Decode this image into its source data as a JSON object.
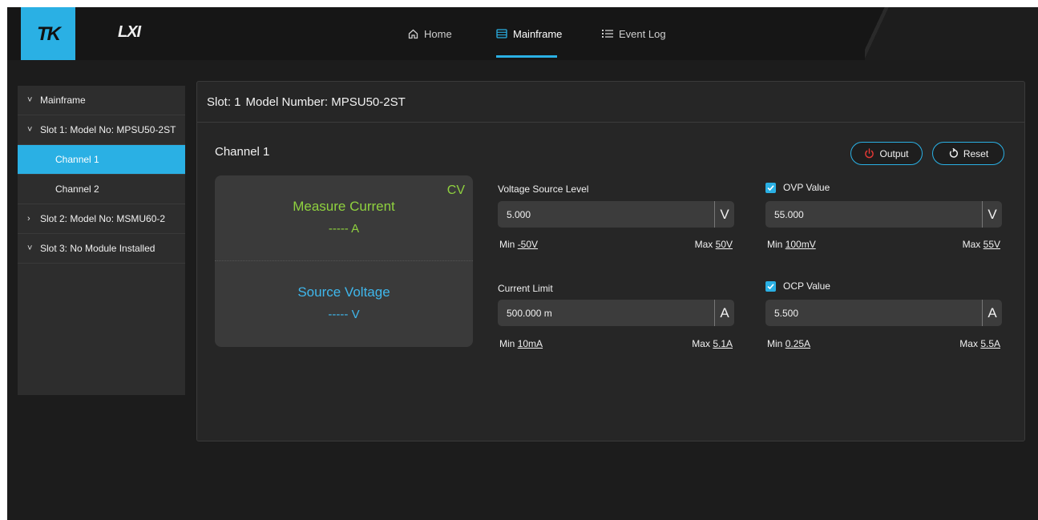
{
  "brand": {
    "logo_text": "TK",
    "lxi_text": "LXI"
  },
  "nav": {
    "home": "Home",
    "mainframe": "Mainframe",
    "event_log": "Event Log",
    "active": "Mainframe"
  },
  "sidebar": {
    "items": [
      {
        "label": "Mainframe",
        "chevron": "˅"
      },
      {
        "label": "Slot 1: Model No: MPSU50-2ST",
        "chevron": "˅"
      },
      {
        "label": "Channel 1",
        "active": true
      },
      {
        "label": "Channel 2"
      },
      {
        "label": "Slot 2: Model No: MSMU60-2",
        "chevron": "›"
      },
      {
        "label": "Slot 3: No Module Installed",
        "chevron": "˅"
      }
    ]
  },
  "panel": {
    "slot_label": "Slot: 1",
    "model_label": "Model Number: MPSU50-2ST",
    "channel_title": "Channel 1",
    "output_button": "Output",
    "reset_button": "Reset"
  },
  "measure": {
    "mode": "CV",
    "current_label": "Measure Current",
    "current_value": "----- A",
    "voltage_label": "Source Voltage",
    "voltage_value": "----- V",
    "colors": {
      "current": "#8fd13f",
      "voltage": "#3fb7ec"
    }
  },
  "fields": {
    "voltage_source": {
      "label": "Voltage Source Level",
      "value": "5.000",
      "unit": "V",
      "min_prefix": "Min",
      "min": "-50V",
      "max_prefix": "Max",
      "max": "50V"
    },
    "ovp": {
      "label": "OVP Value",
      "checked": true,
      "value": "55.000",
      "unit": "V",
      "min_prefix": "Min",
      "min": "100mV",
      "max_prefix": "Max",
      "max": "55V"
    },
    "current_limit": {
      "label": "Current Limit",
      "value": "500.000 m",
      "unit": "A",
      "min_prefix": "Min",
      "min": "10mA",
      "max_prefix": "Max",
      "max": "5.1A"
    },
    "ocp": {
      "label": "OCP Value",
      "checked": true,
      "value": "5.500",
      "unit": "A",
      "min_prefix": "Min",
      "min": "0.25A",
      "max_prefix": "Max",
      "max": "5.5A"
    }
  },
  "icons": {
    "home": "home-icon",
    "mainframe": "mainframe-icon",
    "event_log": "list-icon",
    "power": "power-icon",
    "reset": "reset-icon",
    "check": "check-icon"
  },
  "theme": {
    "accent": "#2ab0e4",
    "power_red": "#e53935",
    "background": "#1c1c1c",
    "panel": "#262626"
  }
}
